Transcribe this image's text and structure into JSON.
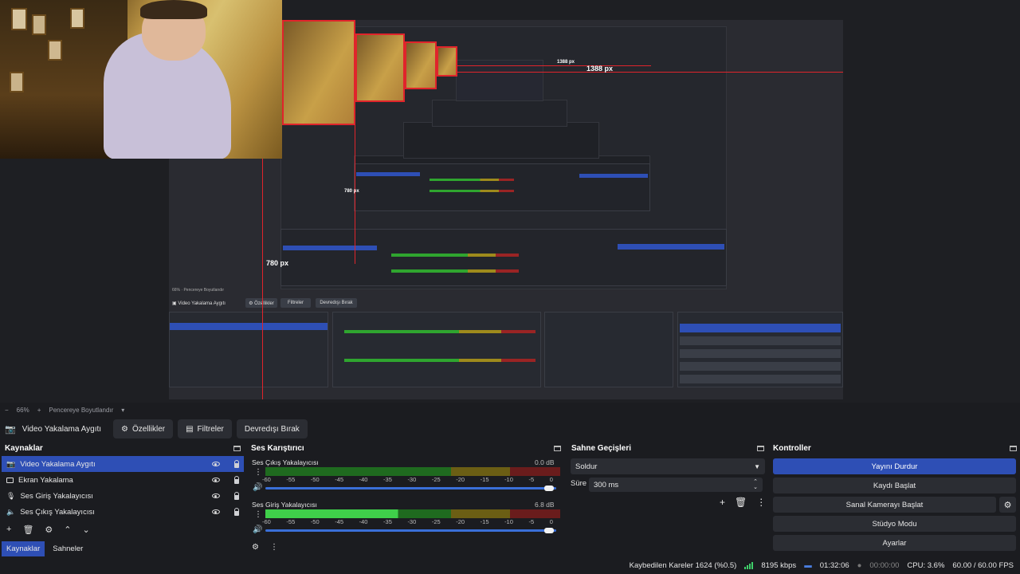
{
  "preview": {
    "px_label_large": "1388 px",
    "px_label_small": "1388 px",
    "px_label_left": "780 px",
    "px_label_left_small": "780 px"
  },
  "zoom": {
    "level": "66%",
    "plus": "+",
    "resize_label": "Pencereye Boyutlandır"
  },
  "source_toolbar": {
    "source_name": "Video Yakalama Aygıtı",
    "properties_label": "Özellikler",
    "filters_label": "Filtreler",
    "deactivate_label": "Devredışı Bırak"
  },
  "sources_dock": {
    "title": "Kaynaklar",
    "items": [
      {
        "label": "Video Yakalama Aygıtı",
        "icon": "camera-icon",
        "selected": true
      },
      {
        "label": "Ekran Yakalama",
        "icon": "monitor-icon",
        "selected": false
      },
      {
        "label": "Ses Giriş Yakalayıcısı",
        "icon": "mic-icon",
        "selected": false
      },
      {
        "label": "Ses Çıkış Yakalayıcısı",
        "icon": "speaker-icon",
        "selected": false
      }
    ],
    "tabs": [
      "Kaynaklar",
      "Sahneler"
    ]
  },
  "mixer_dock": {
    "title": "Ses Karıştırıcı",
    "channels": [
      {
        "name": "Ses Çıkış Yakalayıcısı",
        "db": "0.0 dB",
        "level": 0.0
      },
      {
        "name": "Ses Giriş Yakalayıcısı",
        "db": "6.8 dB",
        "level": 0.82
      }
    ],
    "ticks": [
      "-60",
      "-55",
      "-50",
      "-45",
      "-40",
      "-35",
      "-30",
      "-25",
      "-20",
      "-15",
      "-10",
      "-5",
      "0"
    ]
  },
  "transitions_dock": {
    "title": "Sahne Geçişleri",
    "transition": "Soldur",
    "duration_label": "Süre",
    "duration_value": "300 ms"
  },
  "controls_dock": {
    "title": "Kontroller",
    "buttons": [
      "Yayını Durdur",
      "Kaydı Başlat",
      "Sanal Kamerayı Başlat",
      "Stüdyo Modu",
      "Ayarlar"
    ]
  },
  "status_bar": {
    "dropped_frames": "Kaybedilen Kareler 1624 (%0.5)",
    "bitrate": "8195 kbps",
    "stream_time": "01:32:06",
    "record_time": "00:00:00",
    "cpu": "CPU: 3.6%",
    "fps": "60.00 / 60.00 FPS"
  },
  "colors": {
    "accent": "#2e4fb5",
    "meter_green": "#2fa52f",
    "meter_yellow": "#9e8a1c",
    "meter_red": "#9a2424",
    "red_guide": "#e0242b"
  }
}
